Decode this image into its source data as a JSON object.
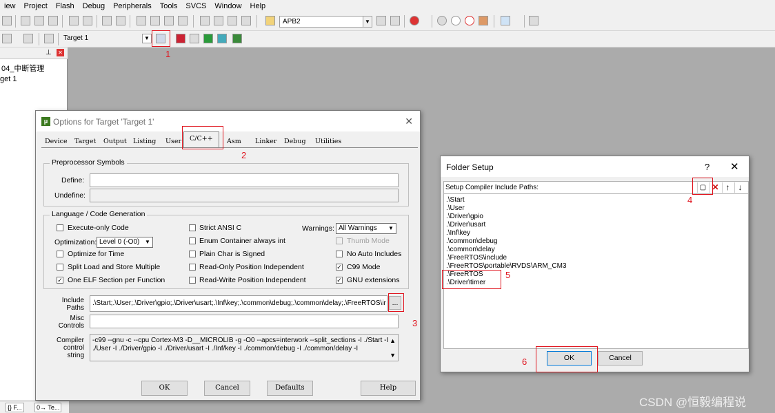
{
  "menubar": [
    "iew",
    "Project",
    "Flash",
    "Debug",
    "Peripherals",
    "Tools",
    "SVCS",
    "Window",
    "Help"
  ],
  "toolbar": {
    "device_combo": "APB2",
    "target_combo": "Target 1"
  },
  "project_pane": {
    "tree": [
      "04_中断管理",
      "get 1"
    ],
    "bottom_tabs": [
      "{} F...",
      "0→ Te..."
    ]
  },
  "annotations": [
    "1",
    "2",
    "3",
    "4",
    "5",
    "6"
  ],
  "options_dialog": {
    "title": "Options for Target 'Target 1'",
    "tabs": [
      "Device",
      "Target",
      "Output",
      "Listing",
      "User",
      "C/C++",
      "Asm",
      "Linker",
      "Debug",
      "Utilities"
    ],
    "preprocessor": {
      "title": "Preprocessor Symbols",
      "define_label": "Define:",
      "undefine_label": "Undefine:",
      "define_value": "",
      "undefine_value": ""
    },
    "codegen": {
      "title": "Language / Code Generation",
      "execute_only": "Execute-only Code",
      "optimization_label": "Optimization:",
      "optimization_value": "Level 0 (-O0)",
      "optimize_time": "Optimize for Time",
      "split_load": "Split Load and Store Multiple",
      "one_elf": "One ELF Section per Function",
      "strict_ansi": "Strict ANSI C",
      "enum_container": "Enum Container always int",
      "plain_char": "Plain Char is Signed",
      "ro_pi": "Read-Only Position Independent",
      "rw_pi": "Read-Write Position Independent",
      "warnings_label": "Warnings:",
      "warnings_value": "All Warnings",
      "thumb_mode": "Thumb Mode",
      "no_auto": "No Auto Includes",
      "c99": "C99 Mode",
      "gnu_ext": "GNU extensions"
    },
    "include_label": "Include\nPaths",
    "include_value": ".\\Start;.\\User;.\\Driver\\gpio;.\\Driver\\usart;.\\Inf\\key;.\\common\\debug;.\\common\\delay;.\\FreeRTOS\\ir",
    "browse_label": "...",
    "misc_label": "Misc\nControls",
    "misc_value": "",
    "compiler_label": "Compiler\ncontrol\nstring",
    "compiler_value_1": "-c99 --gnu -c --cpu Cortex-M3 -D__MICROLIB -g -O0 --apcs=interwork --split_sections -I ./Start -I",
    "compiler_value_2": "./User -I ./Driver/gpio -I ./Driver/usart -I ./Inf/key -I ./common/debug -I ./common/delay -I",
    "ok": "OK",
    "cancel": "Cancel",
    "defaults": "Defaults",
    "help": "Help"
  },
  "folder_setup": {
    "title": "Folder Setup",
    "help": "?",
    "close": "✕",
    "header": "Setup Compiler Include Paths:",
    "paths": [
      ".\\Start",
      ".\\User",
      ".\\Driver\\gpio",
      ".\\Driver\\usart",
      ".\\Inf\\key",
      ".\\common\\debug",
      ".\\common\\delay",
      ".\\FreeRTOS\\include",
      ".\\FreeRTOS\\portable\\RVDS\\ARM_CM3",
      ".\\FreeRTOS",
      ".\\Driver\\timer"
    ],
    "ok": "OK",
    "cancel": "Cancel"
  },
  "watermark": "CSDN @恒毅编程说"
}
